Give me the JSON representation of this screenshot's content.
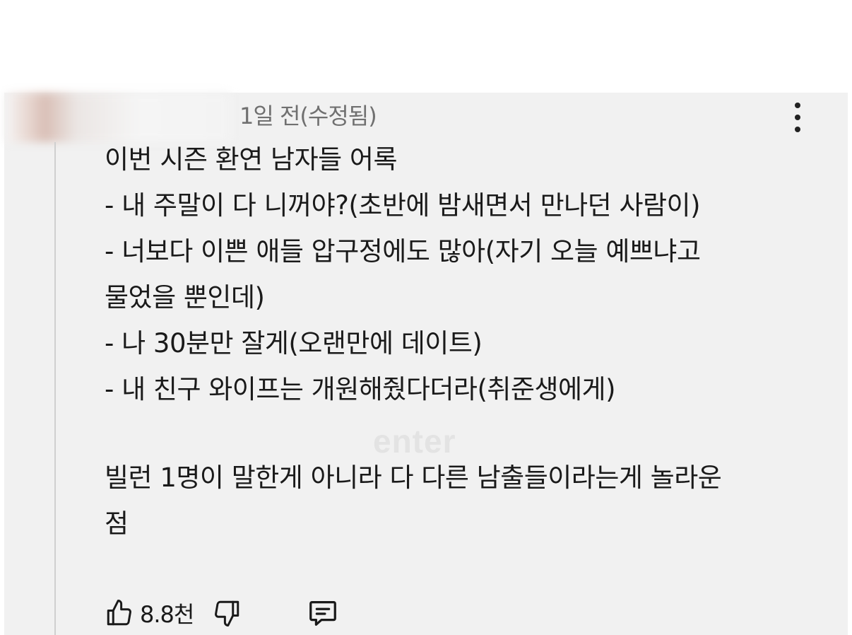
{
  "comment": {
    "timestamp": "1일 전(수정됨)",
    "lines": [
      "이번 시즌 환연 남자들 어록",
      "- 내 주말이 다 니꺼야?(초반에 밤새면서 만나던 사람이)",
      "- 너보다 이쁜 애들 압구정에도 많아(자기 오늘 예쁘냐고",
      "물었을 뿐인데)",
      "- 나 30분만 잘게(오랜만에 데이트)",
      "- 내 친구 와이프는 개원해줬다더라(취준생에게)"
    ],
    "footer_lines": [
      "빌런 1명이 말한게 아니라 다 다른 남출들이라는게 놀라운",
      "점"
    ],
    "watermark": "enter",
    "like_count": "8.8천"
  },
  "icons": {
    "menu": "more-vertical-icon",
    "like": "thumbs-up-icon",
    "dislike": "thumbs-down-icon",
    "reply": "comment-icon"
  }
}
